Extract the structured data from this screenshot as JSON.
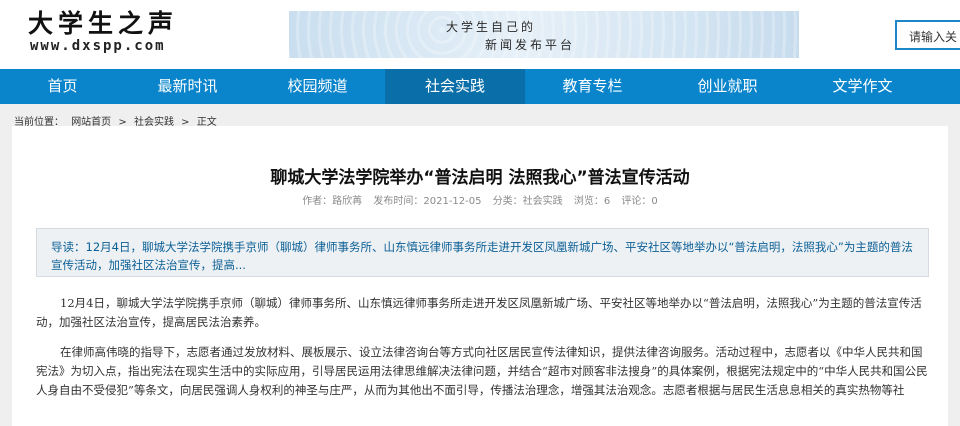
{
  "header": {
    "logo_cn": "大学生之声",
    "logo_url": "www.dxspp.com",
    "banner_line1": "大学生自己的",
    "banner_line2": "新闻发布平台",
    "search_placeholder": "请输入关"
  },
  "nav": {
    "items": [
      {
        "label": "首页"
      },
      {
        "label": "最新时讯"
      },
      {
        "label": "校园频道"
      },
      {
        "label": "社会实践"
      },
      {
        "label": "教育专栏"
      },
      {
        "label": "创业就职"
      },
      {
        "label": "文学作文"
      }
    ],
    "active_index": 3
  },
  "breadcrumb": {
    "prefix": "当前位置：",
    "items": [
      "网站首页",
      "社会实践",
      "正文"
    ],
    "separator": ">"
  },
  "article": {
    "title": "聊城大学法学院举办“普法启明 法照我心”普法宣传活动",
    "meta": {
      "author": "作者：路欣苒",
      "date": "发布时间：2021-12-05",
      "category": "分类：社会实践",
      "views": "浏览：6",
      "comments": "评论：0"
    },
    "summary": "导读：12月4日，聊城大学法学院携手京师（聊城）律师事务所、山东慎远律师事务所走进开发区凤凰新城广场、平安社区等地举办以“普法启明，法照我心”为主题的普法宣传活动，加强社区法治宣传，提高...",
    "paragraphs": [
      "12月4日，聊城大学法学院携手京师（聊城）律师事务所、山东慎远律师事务所走进开发区凤凰新城广场、平安社区等地举办以“普法启明，法照我心”为主题的普法宣传活动，加强社区法治宣传，提高居民法治素养。",
      "在律师高伟晓的指导下，志愿者通过发放材料、展板展示、设立法律咨询台等方式向社区居民宣传法律知识，提供法律咨询服务。活动过程中，志愿者以《中华人民共和国宪法》为切入点，指出宪法在现实生活中的实际应用，引导居民运用法律思维解决法律问题，并结合“超市对顾客非法搜身”的具体案例，根据宪法规定中的“中华人民共和国公民人身自由不受侵犯”等条文，向居民强调人身权利的神圣与庄严，从而为其他出不面引导，传播法治理念，增强其法治观念。志愿者根据与居民生活息息相关的真实热物等社"
    ]
  },
  "colors": {
    "nav_bg": "#0a85cc",
    "nav_active": "#0a6fa9",
    "summary_text": "#0a5f96",
    "search_border": "#1c86c8"
  }
}
